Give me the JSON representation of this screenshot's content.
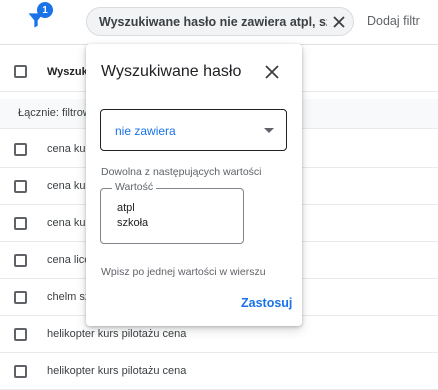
{
  "filter_bar": {
    "filter_count": "1",
    "chip_label": "Wyszukiwane hasło nie zawiera atpl, szkoła",
    "add_filter": "Dodaj filtr"
  },
  "table": {
    "header": "Wyszukiwane hasło",
    "total_label": "Łącznie: filtrowane",
    "rows": [
      "cena kursu pilotażu",
      "cena kursu pilotażu",
      "cena kursu pilotażu",
      "cena licencji pilota",
      "chelm szkoła pilotażu",
      "helikopter kurs pilotażu cena",
      "helikopter kurs pilotażu cena"
    ]
  },
  "dialog": {
    "title": "Wyszukiwane hasło",
    "operator_value": "nie zawiera",
    "any_values_hint": "Dowolna z następujących wartości",
    "value_label": "Wartość",
    "values": [
      "atpl",
      "szkoła"
    ],
    "one_per_line_hint": "Wpisz po jednej wartości w wierszu",
    "apply_label": "Zastosuj"
  },
  "colors": {
    "accent": "#1a73e8",
    "text": "#202124",
    "muted": "#5f6368"
  }
}
